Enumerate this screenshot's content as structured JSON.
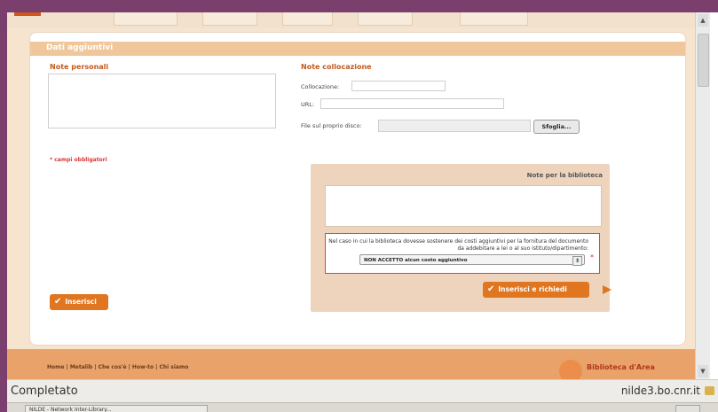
{
  "section": {
    "title": "Dati aggiuntivi"
  },
  "personal_notes": {
    "label": "Note personali",
    "value": ""
  },
  "collocation": {
    "label": "Note collocazione",
    "collocazione_label": "Collocazione:",
    "collocazione_value": "",
    "url_label": "URL:",
    "url_value": "",
    "file_label": "File sul proprio disco:",
    "file_value": "",
    "browse_label": "Sfoglia..."
  },
  "required_note": "* campi obbligatori",
  "library_notes": {
    "title": "Note per la biblioteca",
    "value": ""
  },
  "costs": {
    "text": "Nel caso in cui la biblioteca dovesse sostenere dei costi aggiuntivi per la fornitura del documento da addebitare a lei o al suo istituto/dipartimento:",
    "selected": "NON ACCETTO alcun costo aggiuntivo",
    "required_mark": "*"
  },
  "buttons": {
    "insert": "Inserisci",
    "insert_request": "Inserisci e richiedi"
  },
  "footer": {
    "links": "Home | Metalib | Che cos'è | How-to | Chi siamo",
    "brand": "Biblioteca d'Area"
  },
  "statusbar": {
    "left": "Completato",
    "right": "nilde3.bo.cnr.it"
  },
  "taskbar": {
    "task_label": "NILDE - Network Inter-Library..."
  },
  "colors": {
    "accent": "#e0761f",
    "section": "#efc79b",
    "page_bg": "#f6e4cf",
    "frame": "#7b3f6e"
  }
}
